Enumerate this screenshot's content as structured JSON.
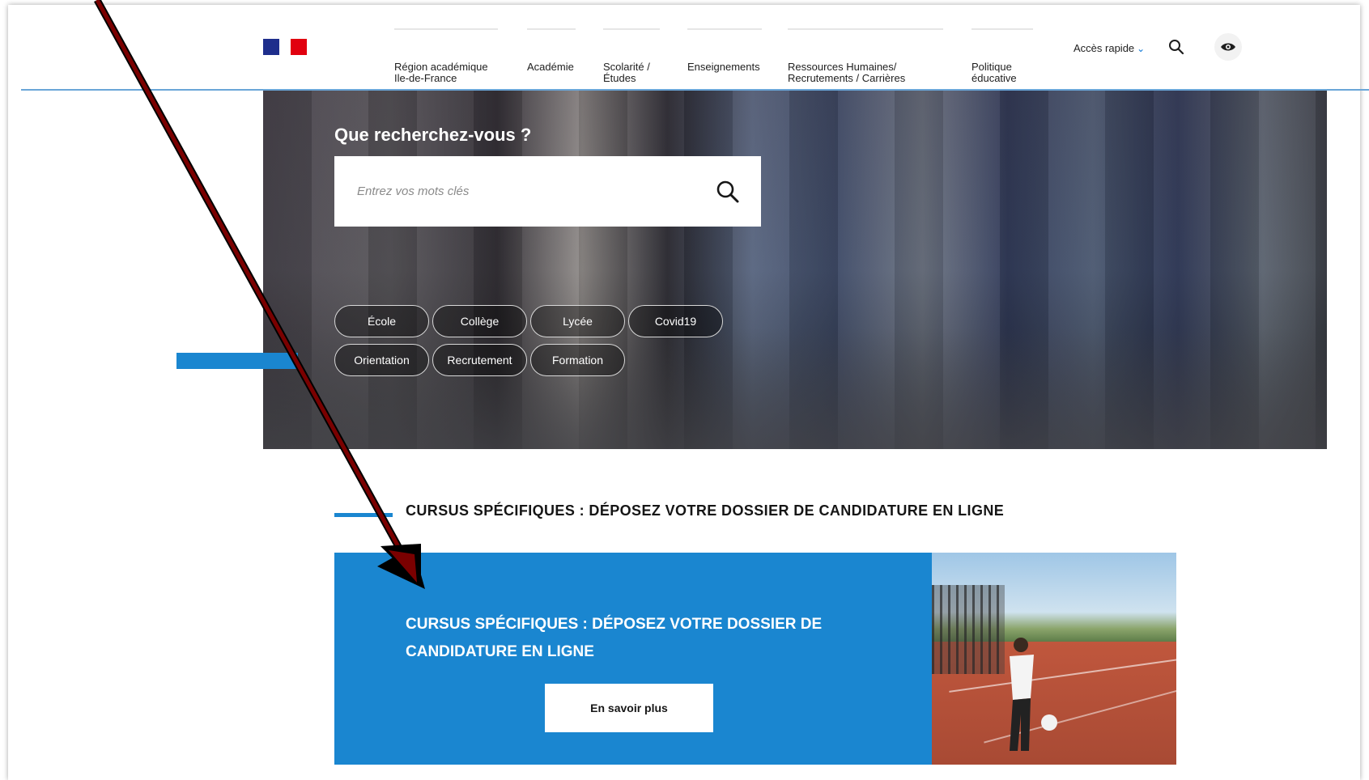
{
  "header": {
    "nav": [
      {
        "label": "Région académique\nIle-de-France"
      },
      {
        "label": "Académie"
      },
      {
        "label": "Scolarité /\nÉtudes"
      },
      {
        "label": "Enseignements"
      },
      {
        "label": "Ressources Humaines/\nRecrutements / Carrières"
      },
      {
        "label": "Politique\néducative"
      }
    ],
    "quick_access": "Accès rapide",
    "icons": {
      "search": "search-icon",
      "accessibility": "eye-icon",
      "logo": "republic-flag-logo"
    }
  },
  "hero": {
    "title": "Que recherchez-vous ?",
    "search_placeholder": "Entrez vos mots clés",
    "tags": [
      "École",
      "Collège",
      "Lycée",
      "Covid19",
      "Orientation",
      "Recrutement",
      "Formation"
    ]
  },
  "section": {
    "title": "CURSUS SPÉCIFIQUES : DÉPOSEZ VOTRE DOSSIER DE CANDIDATURE EN LIGNE"
  },
  "card": {
    "title": "CURSUS SPÉCIFIQUES : DÉPOSEZ VOTRE DOSSIER DE CANDIDATURE EN LIGNE",
    "button": "En savoir plus"
  },
  "colors": {
    "brand_blue": "#1a86d0",
    "flag_blue": "#1e2e8c",
    "flag_red": "#e1000f",
    "annotation_arrow": "#7a0000"
  }
}
